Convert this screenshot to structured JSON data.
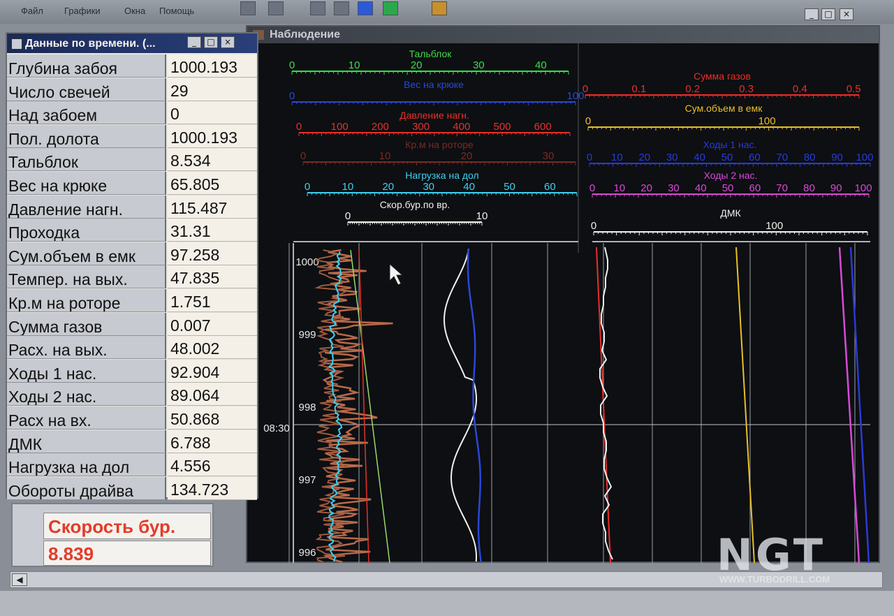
{
  "menu": {
    "items": [
      "Файл",
      "Графики",
      "Окна",
      "Помощь"
    ]
  },
  "data_window": {
    "title": "Данные по времени. (...",
    "rows": [
      {
        "label": "Глубина забоя",
        "value": "1000.193"
      },
      {
        "label": "Число свечей",
        "value": "29"
      },
      {
        "label": "Над забоем",
        "value": "0"
      },
      {
        "label": "Пол. долота",
        "value": "1000.193"
      },
      {
        "label": "Тальблок",
        "value": "8.534"
      },
      {
        "label": "Вес на крюке",
        "value": "65.805"
      },
      {
        "label": "Давление нагн.",
        "value": "115.487"
      },
      {
        "label": "Проходка",
        "value": "31.31"
      },
      {
        "label": "Сум.объем в емк",
        "value": "97.258"
      },
      {
        "label": "Темпер. на вых.",
        "value": "47.835"
      },
      {
        "label": "Кр.м на роторе",
        "value": "1.751"
      },
      {
        "label": "Сумма газов",
        "value": "0.007"
      },
      {
        "label": "Расх. на вых.",
        "value": "48.002"
      },
      {
        "label": "Ходы 1 нас.",
        "value": "92.904"
      },
      {
        "label": "Ходы 2 нас.",
        "value": "89.064"
      },
      {
        "label": "Расх на вх.",
        "value": "50.868"
      },
      {
        "label": "ДМК",
        "value": "6.788"
      },
      {
        "label": "Нагрузка на дол",
        "value": "4.556"
      },
      {
        "label": "Обороты драйва",
        "value": "134.723"
      }
    ]
  },
  "speed_panel": {
    "label": "Скорость бур.",
    "value": "8.839"
  },
  "observation": {
    "title": "Наблюдение",
    "left_scales": [
      {
        "name": "Тальблок",
        "color": "#3ddc4a",
        "ticks": [
          "0",
          "10",
          "20",
          "30",
          "40"
        ]
      },
      {
        "name": "Вес на крюке",
        "color": "#2a48d8",
        "ticks": [
          "0",
          "100"
        ]
      },
      {
        "name": "Давление нагн.",
        "color": "#e8302a",
        "ticks": [
          "0",
          "100",
          "200",
          "300",
          "400",
          "500",
          "600"
        ]
      },
      {
        "name": "Кр.м на роторе",
        "color": "#7a2a22",
        "ticks": [
          "0",
          "10",
          "20",
          "30"
        ]
      },
      {
        "name": "Нагрузка на дол",
        "color": "#3fd0f0",
        "ticks": [
          "0",
          "10",
          "20",
          "30",
          "40",
          "50",
          "60"
        ]
      },
      {
        "name": "Скор.бур.по вр.",
        "color": "#f0f0f0",
        "ticks": [
          "0",
          "10"
        ]
      }
    ],
    "right_scales": [
      {
        "name": "Сумма газов",
        "color": "#e8302a",
        "ticks": [
          "0",
          "0.1",
          "0.2",
          "0.3",
          "0.4",
          "0.5"
        ]
      },
      {
        "name": "Сум.объем в емк",
        "color": "#e8c02a",
        "ticks": [
          "0",
          "100"
        ]
      },
      {
        "name": "Ходы 1 нас.",
        "color": "#2a3ad8",
        "ticks": [
          "0",
          "10",
          "20",
          "30",
          "40",
          "50",
          "60",
          "70",
          "80",
          "90",
          "100"
        ]
      },
      {
        "name": "Ходы 2 нас.",
        "color": "#d84ad8",
        "ticks": [
          "0",
          "10",
          "20",
          "30",
          "40",
          "50",
          "60",
          "70",
          "80",
          "90",
          "100"
        ]
      },
      {
        "name": "ДМК",
        "color": "#f0f0f0",
        "ticks": [
          "0",
          "100"
        ]
      }
    ],
    "depth_labels": [
      "1000",
      "999",
      "998",
      "997",
      "996"
    ],
    "time_label": "08:30"
  },
  "watermark": {
    "logo": "NGT",
    "url": "WWW.TURBODRILL.COM"
  }
}
